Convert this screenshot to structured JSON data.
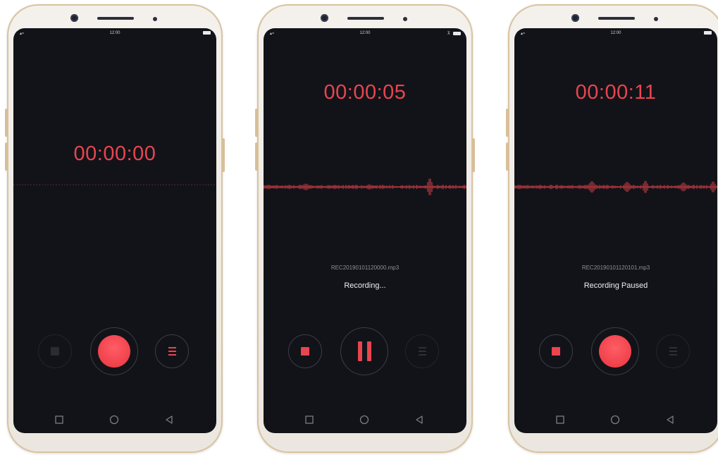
{
  "colors": {
    "accent": "#e8454f",
    "screen_background": "#121318",
    "phone_body": "#f1eee9",
    "phone_trim": "#d9c3a0"
  },
  "screens": [
    {
      "status_time": "12:00",
      "timer": "00:00:00",
      "controls": {
        "stop_icon": "stop-icon",
        "main_icon": "record-icon",
        "list_icon": "list-icon"
      }
    },
    {
      "status_time": "12:00",
      "timer": "00:00:05",
      "file_name": "REC20190101120000.mp3",
      "status_text": "Recording...",
      "controls": {
        "stop_icon": "stop-icon",
        "main_icon": "pause-icon",
        "list_icon": "list-icon"
      }
    },
    {
      "status_time": "12:00",
      "timer": "00:00:11",
      "file_name": "REC20190101120101.mp3",
      "status_text": "Recording Paused",
      "controls": {
        "stop_icon": "stop-icon",
        "main_icon": "record-icon",
        "list_icon": "list-icon"
      }
    }
  ],
  "nav_icons": [
    "recents-square-icon",
    "home-circle-icon",
    "back-triangle-icon"
  ]
}
